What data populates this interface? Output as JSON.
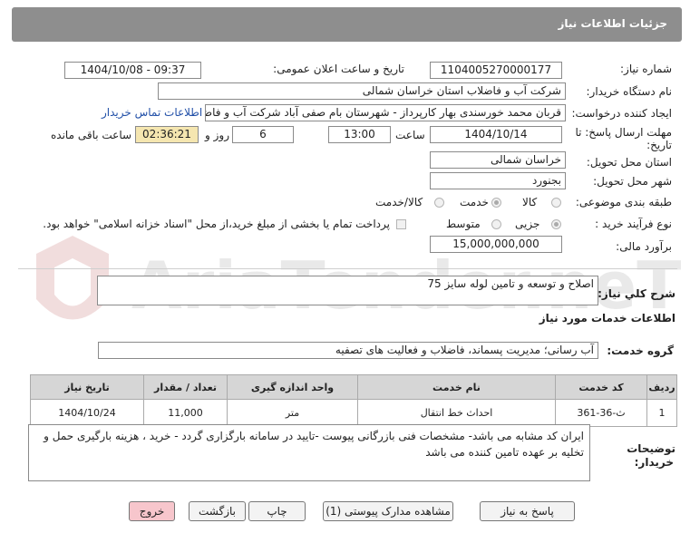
{
  "header": {
    "title": "جزئیات اطلاعات نیاز"
  },
  "watermark": {
    "text": "AriaTender.neT",
    "color": "#c8c8c8"
  },
  "fields": {
    "need_number": {
      "label": "شماره نیاز:",
      "value": "1104005270000177"
    },
    "announce_datetime": {
      "label": "تاریخ و ساعت اعلان عمومی:",
      "value": "1404/10/08 - 09:37"
    },
    "buyer_org": {
      "label": "نام دستگاه خریدار:",
      "value": "شرکت آب و فاضلاب استان خراسان شمالی"
    },
    "creator": {
      "label": "ایجاد کننده درخواست:",
      "value": "قربان محمد خورسندی بهار کارپرداز - شهرستان بام صفی آباد شرکت آب و فاضلا",
      "contact_link": "اطلاعات تماس خریدار"
    },
    "deadline": {
      "label_line1": "مهلت ارسال پاسخ: تا",
      "label_line2": "تاریخ:",
      "date": "1404/10/14",
      "time_label": "ساعت",
      "time": "13:00",
      "days": "6",
      "days_label": "روز و",
      "remaining": "02:36:21",
      "remaining_label": "ساعت باقی مانده"
    },
    "delivery_province": {
      "label": "استان محل تحویل:",
      "value": "خراسان شمالی"
    },
    "delivery_city": {
      "label": "شهر محل تحویل:",
      "value": "بجنورد"
    },
    "category": {
      "label": "طبقه بندی موضوعی:",
      "options": [
        "کالا",
        "خدمت",
        "کالا/خدمت"
      ],
      "selected": "خدمت"
    },
    "purchase_type": {
      "label": "نوع فرآیند خرید :",
      "options": [
        "جزیی",
        "متوسط"
      ],
      "selected": "جزیی",
      "payment_note": "پرداخت تمام یا بخشی از مبلغ خرید،از محل \"اسناد خزانه اسلامی\" خواهد بود."
    },
    "estimate": {
      "label": "برآورد مالی:",
      "value": "15,000,000,000"
    }
  },
  "summary": {
    "label": "شرح کلي نياز:",
    "value": "اصلاح و توسعه و تامین لوله سایز 75"
  },
  "services_section": {
    "title": "اطلاعات خدمات مورد نیاز"
  },
  "service_group": {
    "label": "گروه خدمت:",
    "value": "آب رسانی؛ مدیریت پسماند، فاضلاب و فعالیت های تصفیه"
  },
  "table": {
    "headers": [
      "ردیف",
      "کد خدمت",
      "نام خدمت",
      "واحد اندازه گیری",
      "تعداد / مقدار",
      "تاریخ نیاز"
    ],
    "rows": [
      [
        "1",
        "ث-36-361",
        "احداث خط انتقال",
        "متر",
        "11,000",
        "1404/10/24"
      ]
    ]
  },
  "buyer_notes": {
    "label_line1": "توضیحات",
    "label_line2": "خریدار:",
    "text": "ایران کد مشابه می باشد- مشخصات فنی بازرگانی پیوست -تایید در سامانه بارگزاری گردد - خرید ، هزینه بارگیری حمل و تخلیه بر عهده تامین کننده می باشد"
  },
  "buttons": {
    "reply": "پاسخ به نیاز",
    "attachments": "مشاهده مدارک پیوستی (1)",
    "print": "چاپ",
    "back": "بازگشت",
    "exit": "خروج"
  }
}
